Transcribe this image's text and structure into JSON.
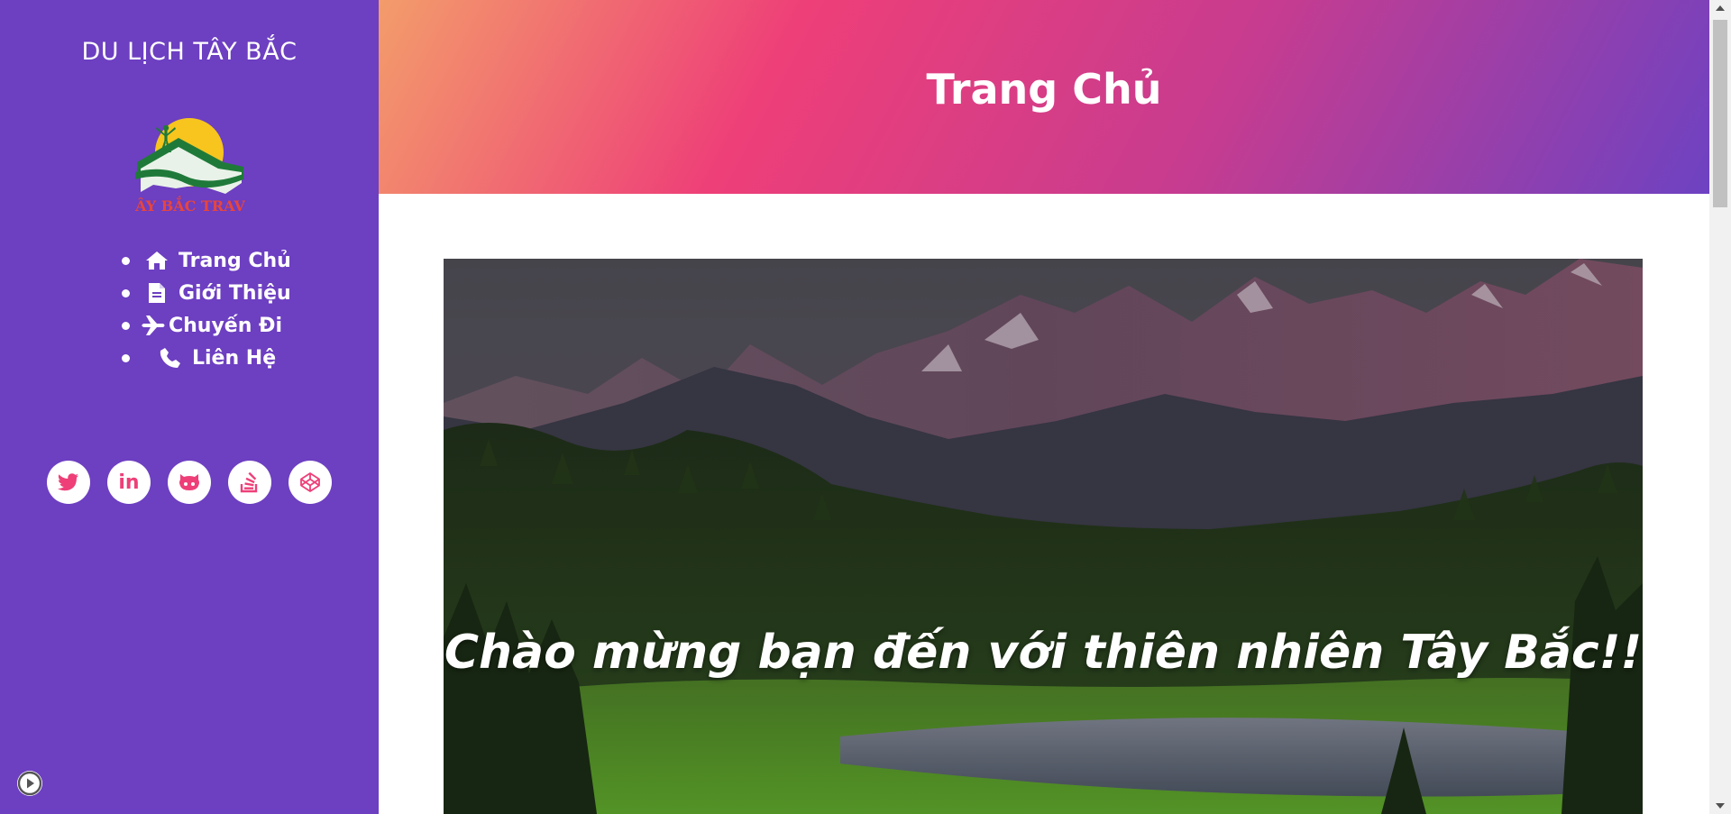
{
  "sidebar": {
    "site_title": "DU LỊCH TÂY BẮC",
    "logo_text": "ÂY BẮC TRAV",
    "nav": [
      {
        "label": "Trang Chủ",
        "icon": "home-icon"
      },
      {
        "label": "Giới Thiệu",
        "icon": "document-icon"
      },
      {
        "label": "Chuyến Đi",
        "icon": "plane-icon"
      },
      {
        "label": "Liên Hệ",
        "icon": "phone-icon"
      }
    ],
    "socials": [
      {
        "name": "twitter",
        "icon": "twitter-icon"
      },
      {
        "name": "linkedin",
        "icon": "linkedin-icon",
        "text": "in"
      },
      {
        "name": "github",
        "icon": "github-icon"
      },
      {
        "name": "stackoverflow",
        "icon": "stackoverflow-icon"
      },
      {
        "name": "codepen",
        "icon": "codepen-icon"
      }
    ]
  },
  "header": {
    "title": "Trang Chủ"
  },
  "hero": {
    "caption": "Chào mừng bạn đến với thiên nhiên Tây Bắc!!"
  },
  "colors": {
    "sidebar": "#6d3fc1",
    "accent_pink": "#ee3f78",
    "accent_orange": "#f39c6b"
  }
}
